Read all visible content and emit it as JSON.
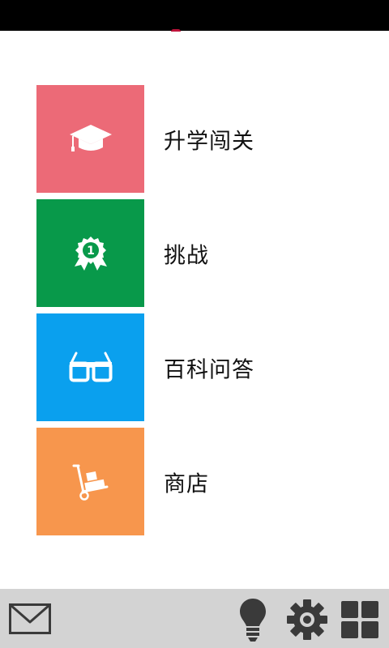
{
  "menu": {
    "items": [
      {
        "label": "升学闯关",
        "icon": "graduation-cap-icon",
        "color": "#ec6a77"
      },
      {
        "label": "挑战",
        "icon": "award-ribbon-icon",
        "color": "#08994a",
        "badge": "1"
      },
      {
        "label": "百科问答",
        "icon": "glasses-icon",
        "color": "#0aa0ee"
      },
      {
        "label": "商店",
        "icon": "hand-truck-icon",
        "color": "#f7964d"
      }
    ]
  },
  "bottom_bar": {
    "background": "#d3d3d3",
    "icon_color": "#3a3a3a",
    "icons": [
      "mail-icon",
      "lightbulb-icon",
      "settings-gear-icon",
      "grid-menu-icon"
    ]
  }
}
